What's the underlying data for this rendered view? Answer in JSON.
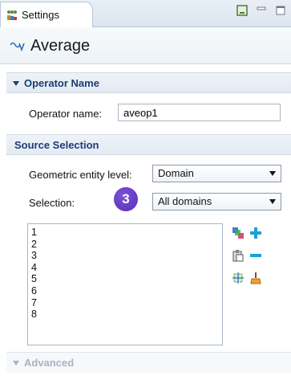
{
  "window": {
    "tab_label": "Settings",
    "tab_icon": "settings-icon",
    "toolbar_icons": [
      "help-icon",
      "minimize-icon",
      "maximize-icon"
    ]
  },
  "header": {
    "title": "Average",
    "icon": "average-operator-icon"
  },
  "sections": {
    "operator_name": {
      "title": "Operator Name",
      "field_label": "Operator name:",
      "field_value": "aveop1"
    },
    "source_selection": {
      "title": "Source Selection",
      "geometric_entity_label": "Geometric entity level:",
      "geometric_entity_value": "Domain",
      "selection_label": "Selection:",
      "selection_value": "All domains",
      "step_badge": "3",
      "domains": [
        "1",
        "2",
        "3",
        "4",
        "5",
        "6",
        "7",
        "8"
      ],
      "side_icons": [
        "paste-selection-icon",
        "add-to-selection-icon",
        "copy-icon",
        "remove-from-selection-icon",
        "zoom-to-selection-icon",
        "clear-selection-icon"
      ]
    },
    "advanced": {
      "title": "Advanced"
    }
  },
  "colors": {
    "section_title": "#1c3d73",
    "badge": "#6a3fcc",
    "add_icon": "#1aa1d8",
    "remove_icon": "#1aa1d8"
  }
}
